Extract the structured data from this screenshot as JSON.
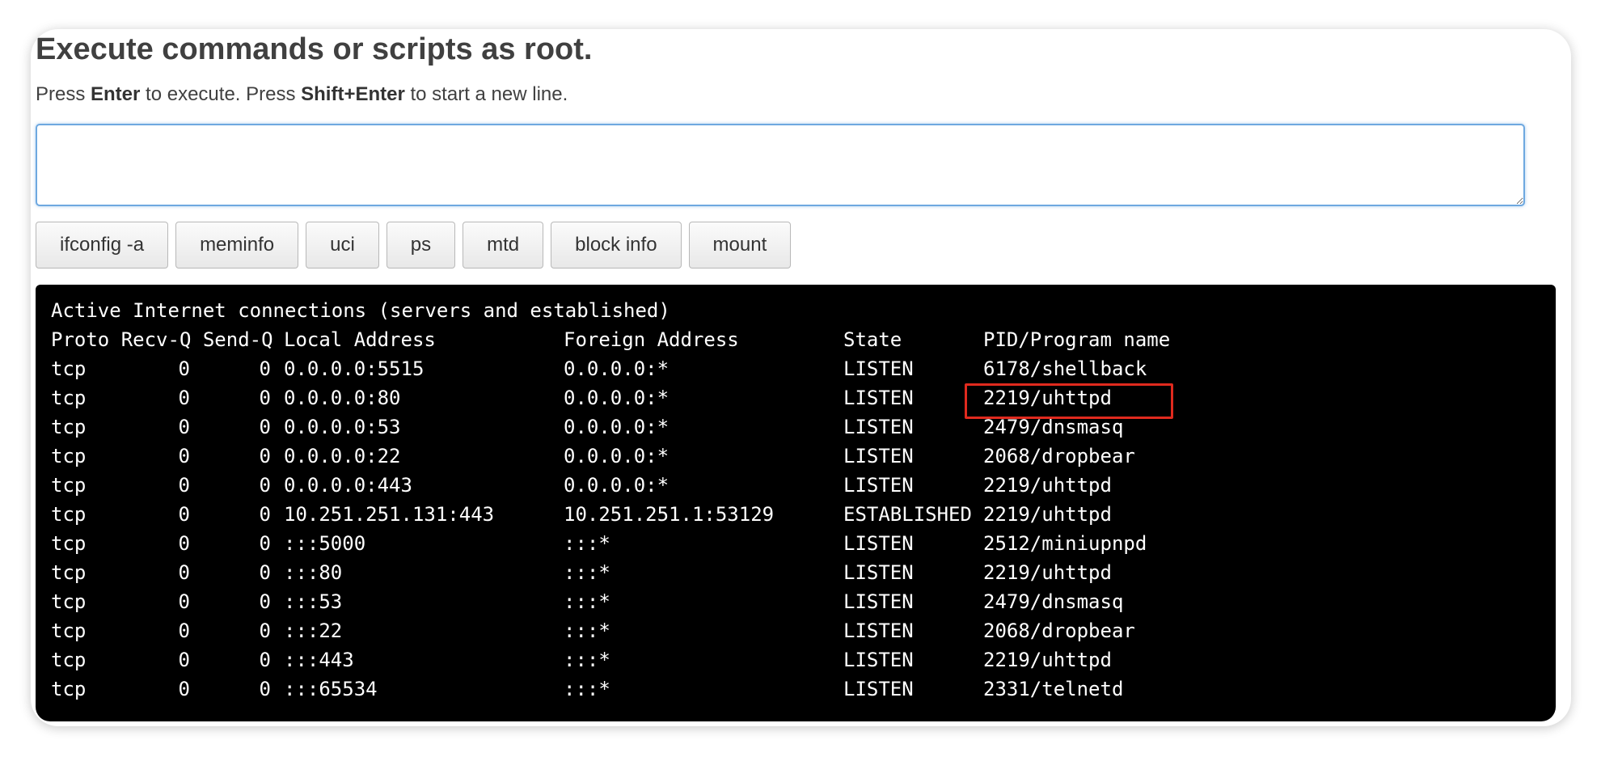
{
  "page": {
    "title": "Execute commands or scripts as root.",
    "hint_press_1": "Press ",
    "hint_key_1": "Enter",
    "hint_mid": " to execute. Press ",
    "hint_key_2": "Shift+Enter",
    "hint_end": " to start a new line."
  },
  "command_input": {
    "value": "",
    "placeholder": ""
  },
  "quick_buttons": [
    "ifconfig -a",
    "meminfo",
    "uci",
    "ps",
    "mtd",
    "block info",
    "mount"
  ],
  "terminal": {
    "title_line": "Active Internet connections (servers and established)",
    "headers": {
      "proto_recv_send": "Proto Recv-Q Send-Q",
      "local": "Local Address",
      "foreign": "Foreign Address",
      "state": "State",
      "pid": "PID/Program name"
    },
    "rows": [
      {
        "proto": "tcp",
        "recv_q": "0",
        "send_q": "0",
        "local": "0.0.0.0:5515",
        "foreign": "0.0.0.0:*",
        "state": "LISTEN",
        "pid_program": "6178/shellback"
      },
      {
        "proto": "tcp",
        "recv_q": "0",
        "send_q": "0",
        "local": "0.0.0.0:80",
        "foreign": "0.0.0.0:*",
        "state": "LISTEN",
        "pid_program": "2219/uhttpd"
      },
      {
        "proto": "tcp",
        "recv_q": "0",
        "send_q": "0",
        "local": "0.0.0.0:53",
        "foreign": "0.0.0.0:*",
        "state": "LISTEN",
        "pid_program": "2479/dnsmasq"
      },
      {
        "proto": "tcp",
        "recv_q": "0",
        "send_q": "0",
        "local": "0.0.0.0:22",
        "foreign": "0.0.0.0:*",
        "state": "LISTEN",
        "pid_program": "2068/dropbear"
      },
      {
        "proto": "tcp",
        "recv_q": "0",
        "send_q": "0",
        "local": "0.0.0.0:443",
        "foreign": "0.0.0.0:*",
        "state": "LISTEN",
        "pid_program": "2219/uhttpd"
      },
      {
        "proto": "tcp",
        "recv_q": "0",
        "send_q": "0",
        "local": "10.251.251.131:443",
        "foreign": "10.251.251.1:53129",
        "state": "ESTABLISHED",
        "pid_program": "2219/uhttpd"
      },
      {
        "proto": "tcp",
        "recv_q": "0",
        "send_q": "0",
        "local": ":::5000",
        "foreign": ":::*",
        "state": "LISTEN",
        "pid_program": "2512/miniupnpd"
      },
      {
        "proto": "tcp",
        "recv_q": "0",
        "send_q": "0",
        "local": ":::80",
        "foreign": ":::*",
        "state": "LISTEN",
        "pid_program": "2219/uhttpd"
      },
      {
        "proto": "tcp",
        "recv_q": "0",
        "send_q": "0",
        "local": ":::53",
        "foreign": ":::*",
        "state": "LISTEN",
        "pid_program": "2479/dnsmasq"
      },
      {
        "proto": "tcp",
        "recv_q": "0",
        "send_q": "0",
        "local": ":::22",
        "foreign": ":::*",
        "state": "LISTEN",
        "pid_program": "2068/dropbear"
      },
      {
        "proto": "tcp",
        "recv_q": "0",
        "send_q": "0",
        "local": ":::443",
        "foreign": ":::*",
        "state": "LISTEN",
        "pid_program": "2219/uhttpd"
      },
      {
        "proto": "tcp",
        "recv_q": "0",
        "send_q": "0",
        "local": ":::65534",
        "foreign": ":::*",
        "state": "LISTEN",
        "pid_program": "2331/telnetd"
      }
    ]
  },
  "colors": {
    "terminal_bg": "#000000",
    "terminal_fg": "#ffffff",
    "highlight_box": "#e02a1e",
    "input_focus_border": "#6ea8e0"
  }
}
